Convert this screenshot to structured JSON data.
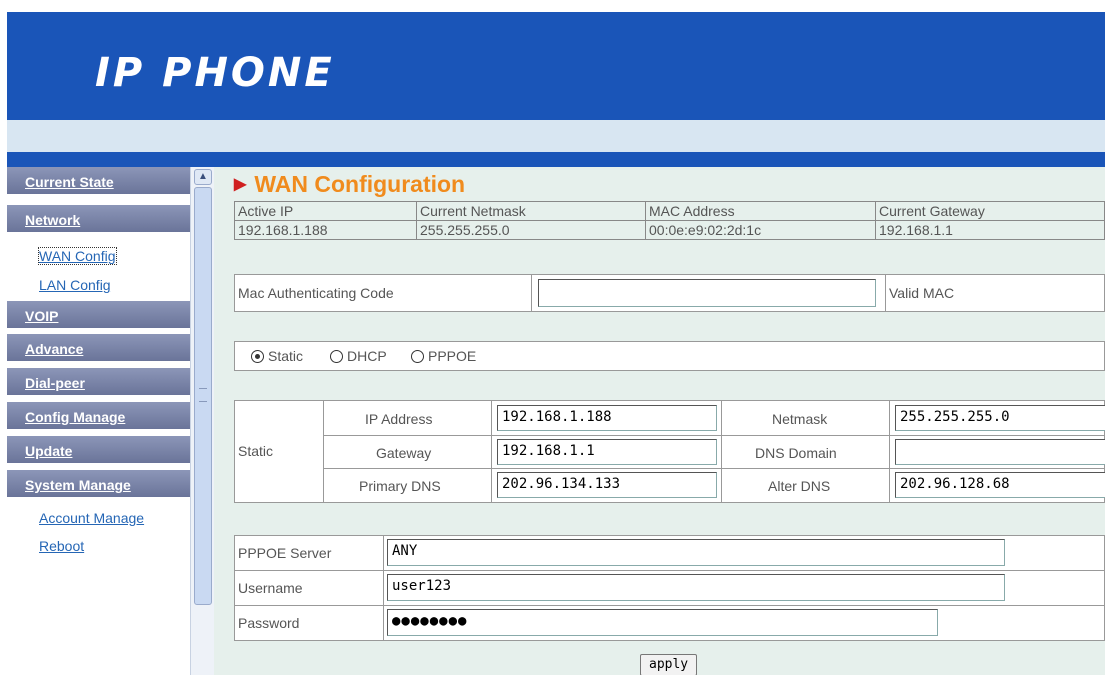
{
  "header": {
    "logo": "IP PHONE"
  },
  "sidebar": {
    "current_state": "Current State",
    "network": "Network",
    "wan_config": "WAN Config",
    "lan_config": "LAN Config",
    "voip": "VOIP",
    "advance": "Advance",
    "dial_peer": "Dial-peer",
    "config_manage": "Config Manage",
    "update": "Update",
    "system_manage": "System Manage",
    "account_manage": "Account Manage",
    "reboot": "Reboot"
  },
  "main": {
    "title": "WAN Configuration",
    "status": {
      "headers": [
        "Active IP",
        "Current Netmask",
        "MAC Address",
        "Current Gateway"
      ],
      "values": [
        "192.168.1.188",
        "255.255.255.0",
        "00:0e:e9:02:2d:1c",
        "192.168.1.1"
      ]
    },
    "mac_auth": {
      "label": "Mac Authenticating Code",
      "value": "",
      "valid": "Valid MAC"
    },
    "mode": {
      "options": [
        "Static",
        "DHCP",
        "PPPOE"
      ],
      "selected": "Static"
    },
    "static": {
      "group_label": "Static",
      "ip_label": "IP Address",
      "ip": "192.168.1.188",
      "netmask_label": "Netmask",
      "netmask": "255.255.255.0",
      "gateway_label": "Gateway",
      "gateway": "192.168.1.1",
      "dns_domain_label": "DNS Domain",
      "dns_domain": "",
      "primary_dns_label": "Primary DNS",
      "primary_dns": "202.96.134.133",
      "alter_dns_label": "Alter DNS",
      "alter_dns": "202.96.128.68"
    },
    "pppoe": {
      "server_label": "PPPOE Server",
      "server": "ANY",
      "username_label": "Username",
      "username": "user123",
      "password_label": "Password",
      "password": "●●●●●●●●"
    },
    "apply_label": "apply"
  }
}
